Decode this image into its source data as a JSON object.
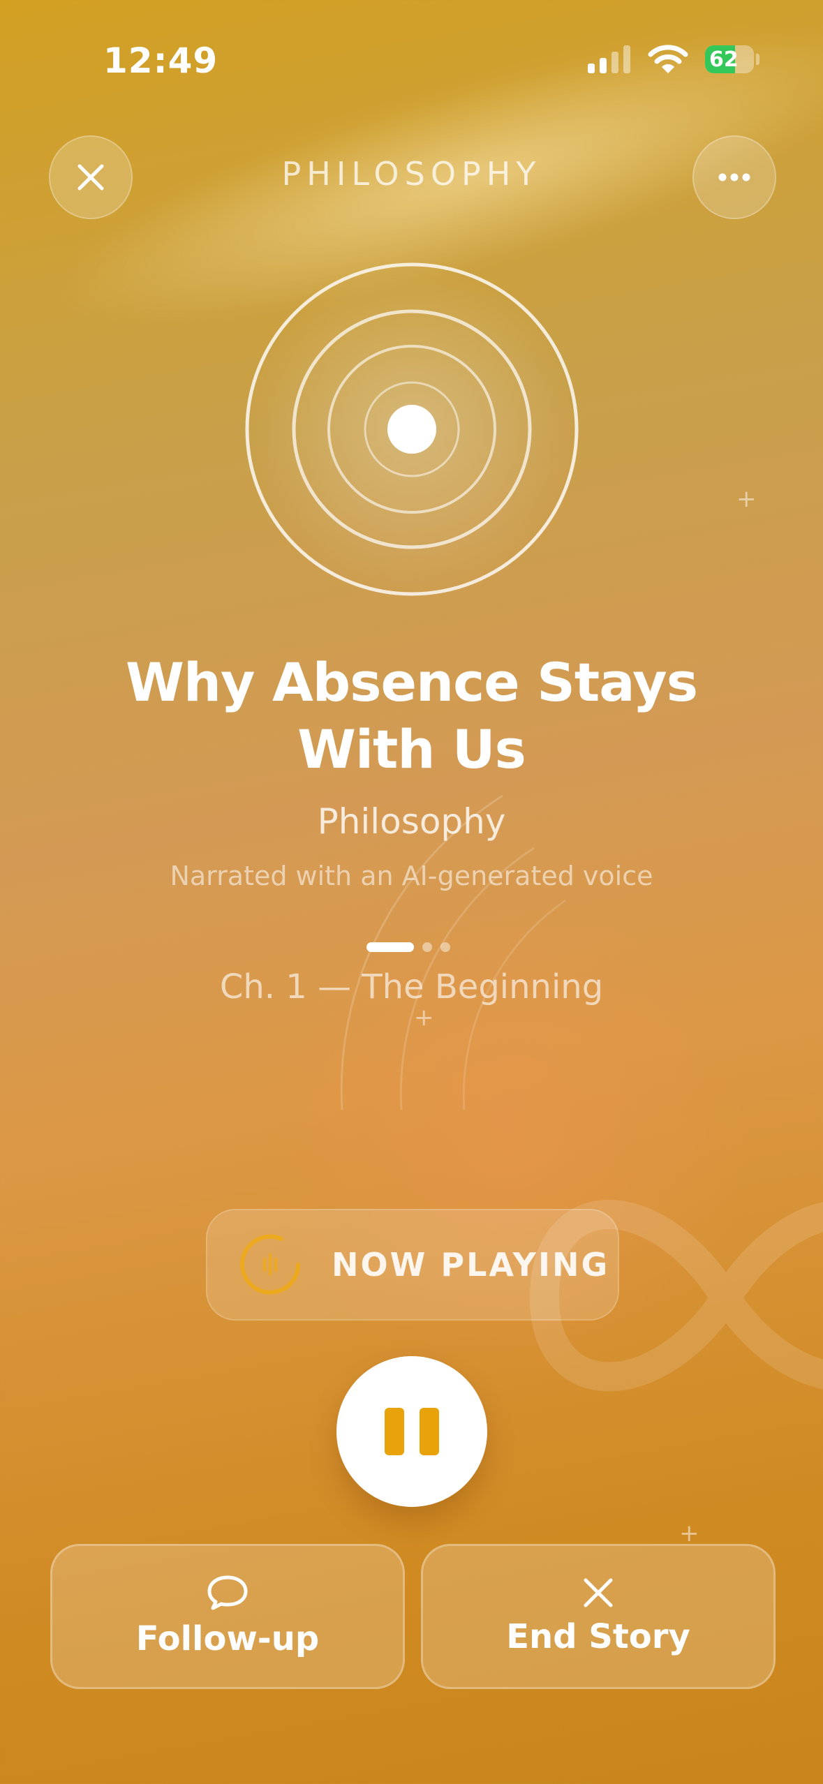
{
  "status_bar": {
    "time": "12:49",
    "battery": "62",
    "battery_level": 0.62
  },
  "header": {
    "title": "PHILOSOPHY",
    "close_icon": "close-icon",
    "more_icon": "more-icon"
  },
  "story": {
    "title": "Why Absence Stays With Us",
    "category": "Philosophy",
    "narration_note": "Narrated with an AI-generated voice",
    "chapter": "Ch. 1 — The Beginning",
    "pages_total": 3,
    "current_page": 1
  },
  "player": {
    "status": "NOW PLAYING",
    "pause_icon": "pause-icon"
  },
  "actions": {
    "follow_up": {
      "label": "Follow-up",
      "icon": "chat-bubble-icon"
    },
    "end_story": {
      "label": "End Story",
      "icon": "close-icon"
    }
  },
  "colors": {
    "accent": "#e8a20a",
    "battery_green": "#34c759"
  }
}
